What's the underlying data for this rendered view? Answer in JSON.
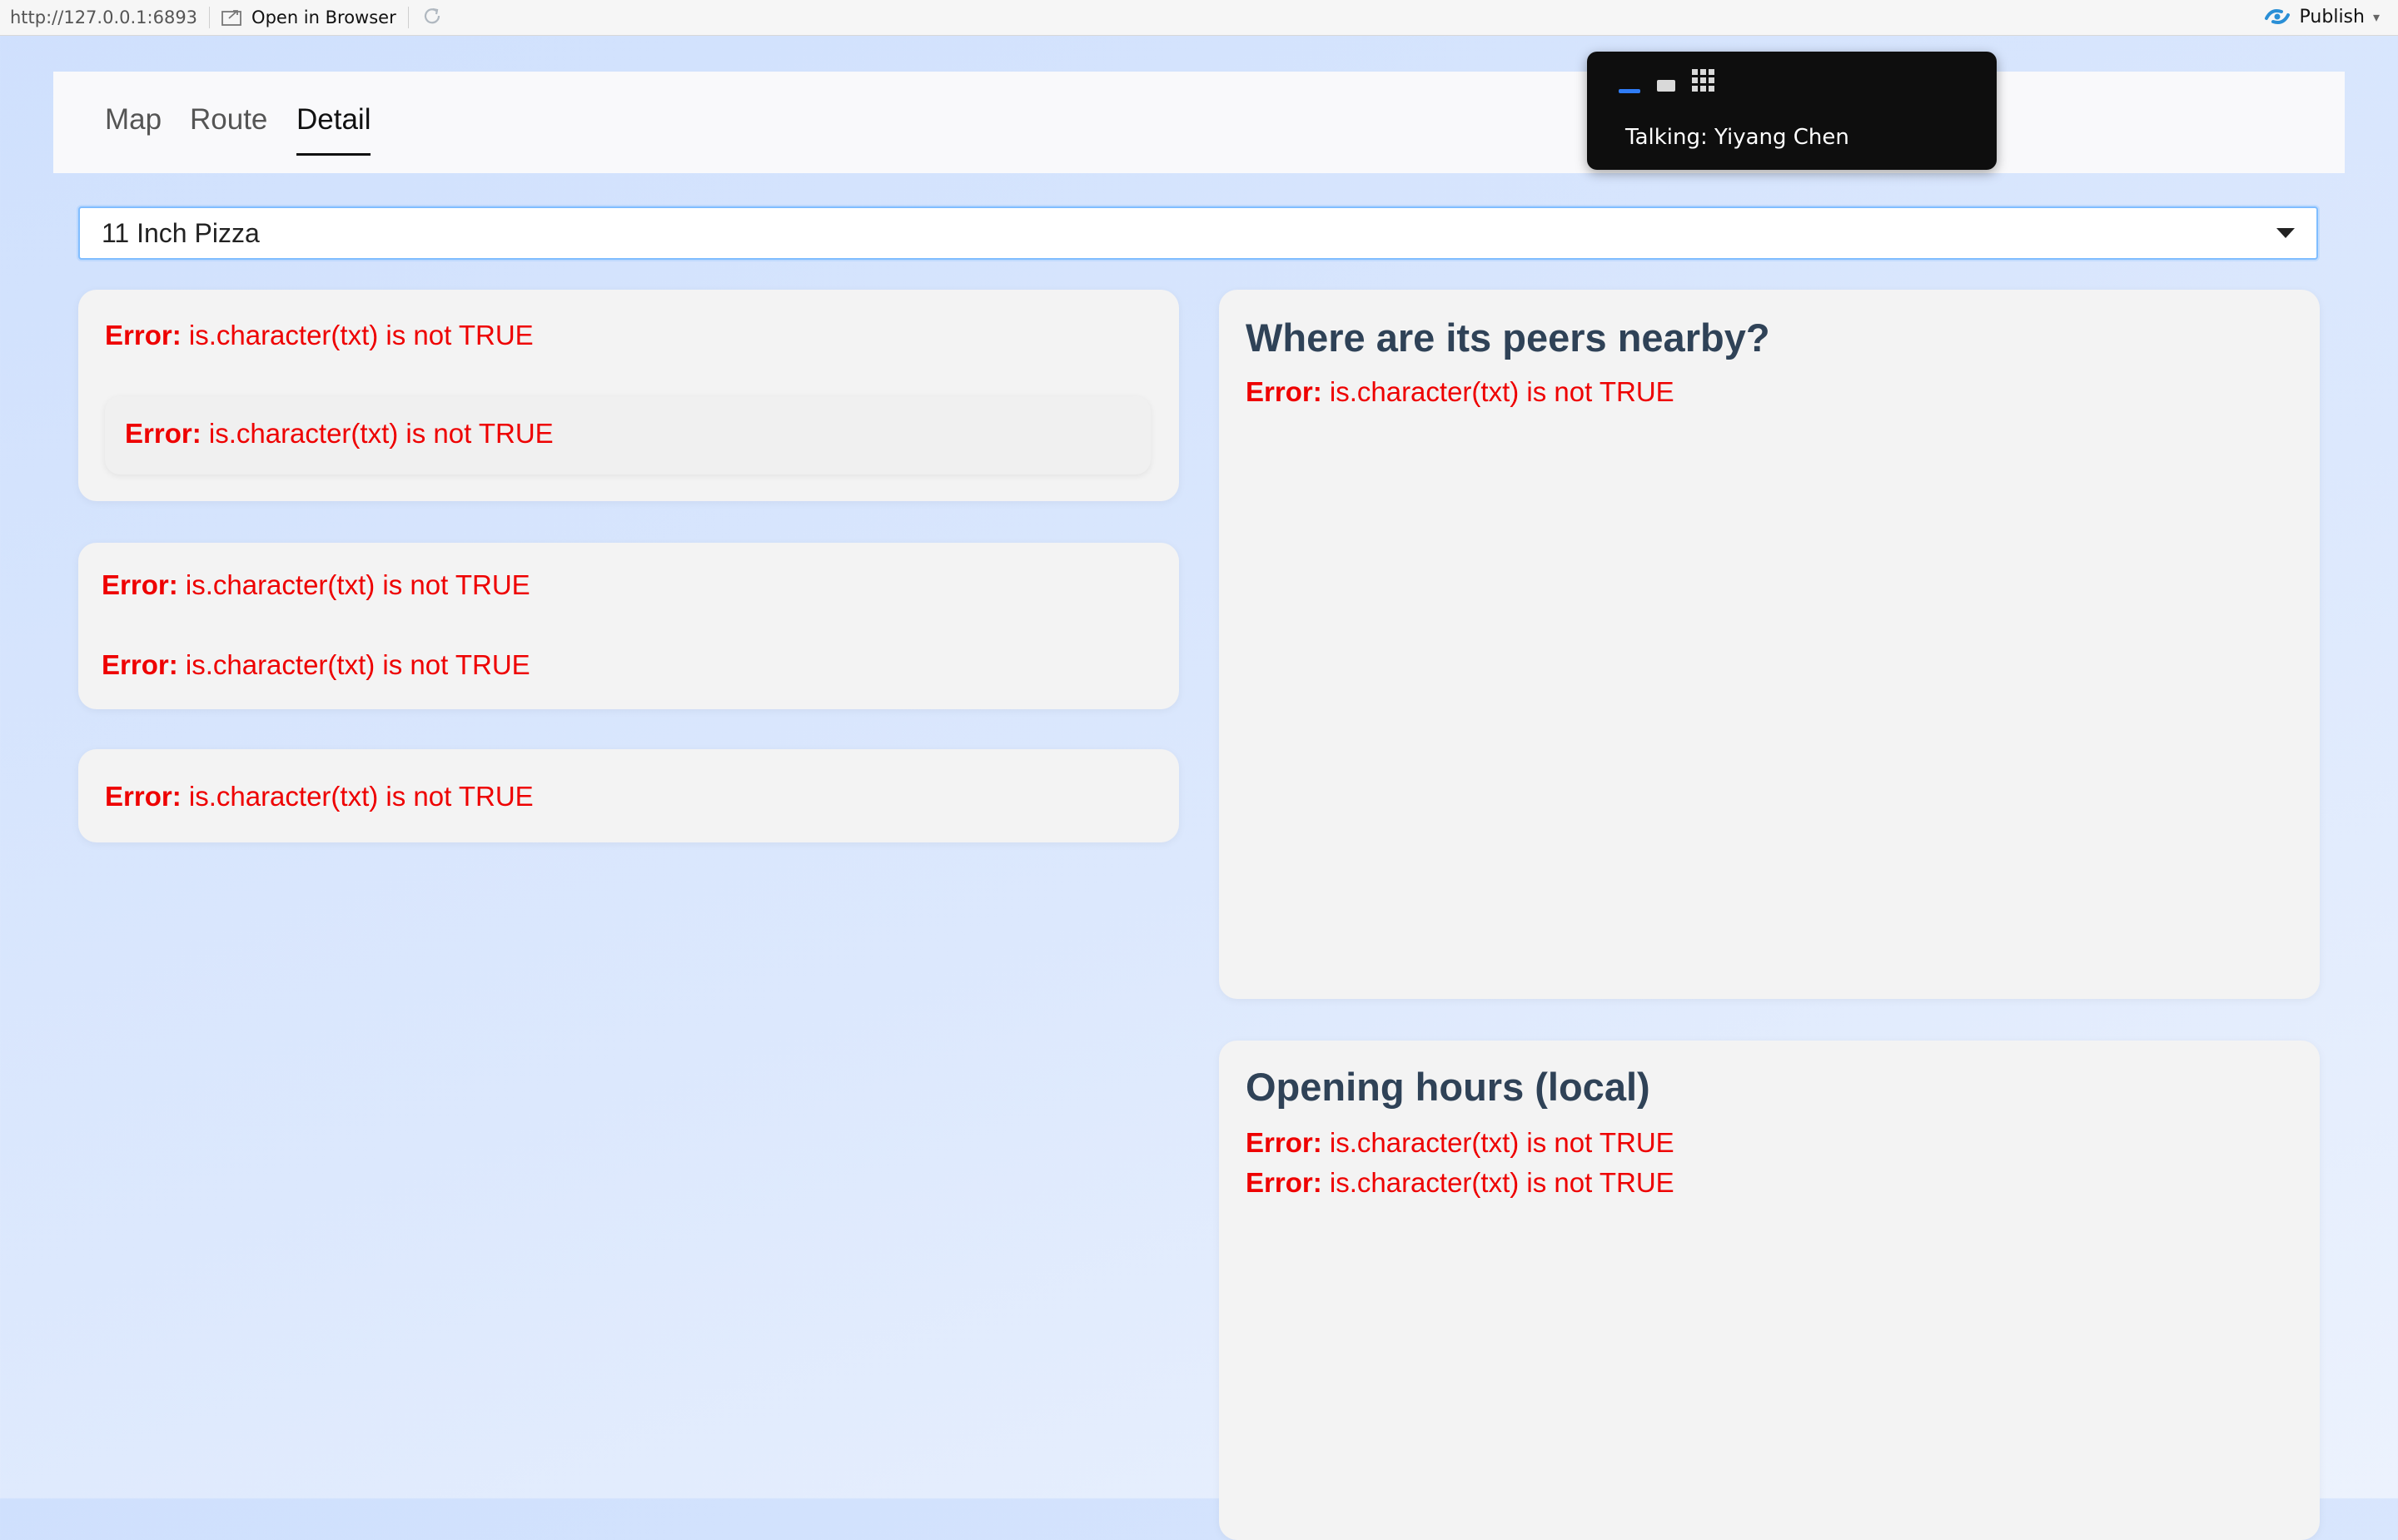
{
  "browser_bar": {
    "url": "http://127.0.0.1:6893",
    "open_label": "Open in Browser",
    "publish_label": "Publish"
  },
  "nav": {
    "tabs": [
      {
        "label": "Map",
        "active": false
      },
      {
        "label": "Route",
        "active": false
      },
      {
        "label": "Detail",
        "active": true
      }
    ]
  },
  "select": {
    "value": "11 Inch Pizza"
  },
  "errors": {
    "prefix": "Error:",
    "message": "is.character(txt) is not TRUE"
  },
  "peers_card": {
    "title": "Where are its peers nearby?"
  },
  "hours_card": {
    "title": "Opening hours (local)"
  },
  "popup": {
    "text": "Talking: Yiyang Chen"
  },
  "colors": {
    "error": "#ee0000",
    "title": "#2f4257",
    "accent": "#80bdff",
    "page_bg": "#d6e4fd"
  }
}
